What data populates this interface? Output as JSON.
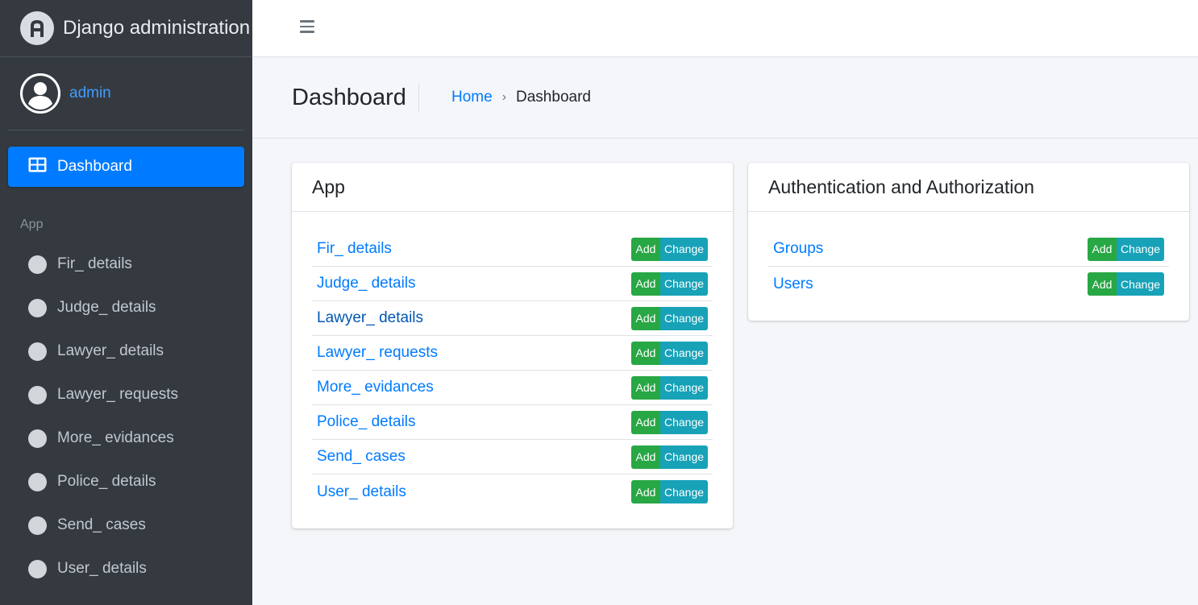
{
  "brand": {
    "title": "Django administration"
  },
  "user": {
    "name": "admin"
  },
  "sidebar": {
    "active": {
      "label": "Dashboard"
    },
    "section_header": "App",
    "items": [
      {
        "label": "Fir_ details"
      },
      {
        "label": "Judge_ details"
      },
      {
        "label": "Lawyer_ details"
      },
      {
        "label": "Lawyer_ requests"
      },
      {
        "label": "More_ evidances"
      },
      {
        "label": "Police_ details"
      },
      {
        "label": "Send_ cases"
      },
      {
        "label": "User_ details"
      }
    ]
  },
  "header": {
    "title": "Dashboard",
    "breadcrumb": {
      "home": "Home",
      "separator": "›",
      "current": "Dashboard"
    }
  },
  "app_card": {
    "title": "App",
    "models": [
      {
        "name": "Fir_ details",
        "add": "Add",
        "change": "Change"
      },
      {
        "name": "Judge_ details",
        "add": "Add",
        "change": "Change"
      },
      {
        "name": "Lawyer_ details",
        "add": "Add",
        "change": "Change"
      },
      {
        "name": "Lawyer_ requests",
        "add": "Add",
        "change": "Change"
      },
      {
        "name": "More_ evidances",
        "add": "Add",
        "change": "Change"
      },
      {
        "name": "Police_ details",
        "add": "Add",
        "change": "Change"
      },
      {
        "name": "Send_ cases",
        "add": "Add",
        "change": "Change"
      },
      {
        "name": "User_ details",
        "add": "Add",
        "change": "Change"
      }
    ]
  },
  "auth_card": {
    "title": "Authentication and Authorization",
    "models": [
      {
        "name": "Groups",
        "add": "Add",
        "change": "Change"
      },
      {
        "name": "Users",
        "add": "Add",
        "change": "Change"
      }
    ]
  },
  "colors": {
    "sidebar_bg": "#343a40",
    "primary": "#007bff",
    "add_button": "#28a745",
    "change_button": "#17a2b8"
  },
  "icons": {
    "brand": "django-logo-icon",
    "user": "user-avatar-icon",
    "dashboard": "grid-icon",
    "menu": "hamburger-icon",
    "nav_item": "circle-icon"
  }
}
